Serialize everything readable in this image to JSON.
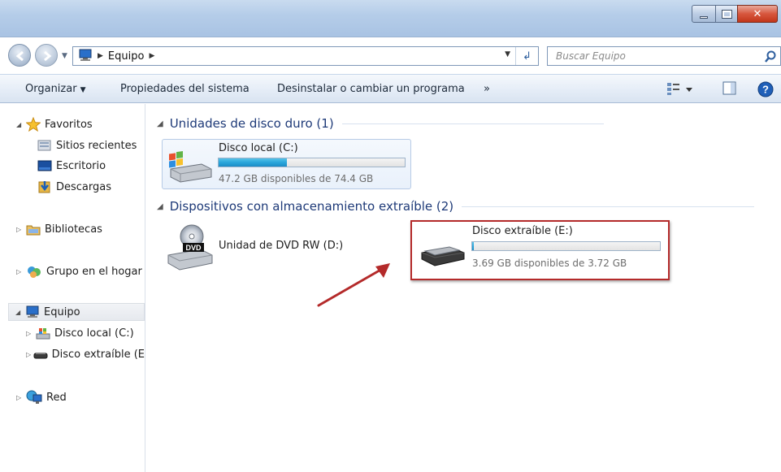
{
  "window": {
    "controls": [
      "minimize",
      "maximize",
      "close"
    ]
  },
  "address": {
    "crumb": "Equipo",
    "search_placeholder": "Buscar Equipo"
  },
  "toolbar": {
    "organize": "Organizar",
    "system_properties": "Propiedades del sistema",
    "uninstall": "Desinstalar o cambiar un programa",
    "more": "»"
  },
  "nav": {
    "favorites": "Favoritos",
    "recent": "Sitios recientes",
    "desktop": "Escritorio",
    "downloads": "Descargas",
    "libraries": "Bibliotecas",
    "homegroup": "Grupo en el hogar",
    "computer": "Equipo",
    "local_disk": "Disco local (C:)",
    "removable": "Disco extraíble (E",
    "network": "Red"
  },
  "groups": {
    "hdd_title": "Unidades de disco duro (1)",
    "removable_title": "Dispositivos con almacenamiento extraíble (2)"
  },
  "drives": {
    "c": {
      "name": "Disco local (C:)",
      "free": "47.2 GB disponibles de 74.4 GB",
      "used_fraction": 0.366
    },
    "dvd": {
      "name": "Unidad de DVD RW (D:)",
      "badge": "DVD"
    },
    "e": {
      "name": "Disco extraíble (E:)",
      "free": "3.69 GB disponibles de 3.72 GB",
      "used_fraction": 0.008
    }
  },
  "icons": [
    "back-icon",
    "forward-icon",
    "computer-icon",
    "refresh-icon",
    "search-icon",
    "views-icon",
    "preview-pane-icon",
    "help-icon",
    "star-icon",
    "recent-places-icon",
    "desktop-icon",
    "downloads-icon",
    "libraries-icon",
    "homegroup-icon",
    "local-disk-icon",
    "removable-disk-icon",
    "network-icon",
    "dvd-drive-icon"
  ],
  "colors": {
    "accent": "#1e3a78",
    "highlight_border": "#b42a2a",
    "capacity_fill": "#27a3d9",
    "annotation_arrow": "#b42a2a"
  }
}
